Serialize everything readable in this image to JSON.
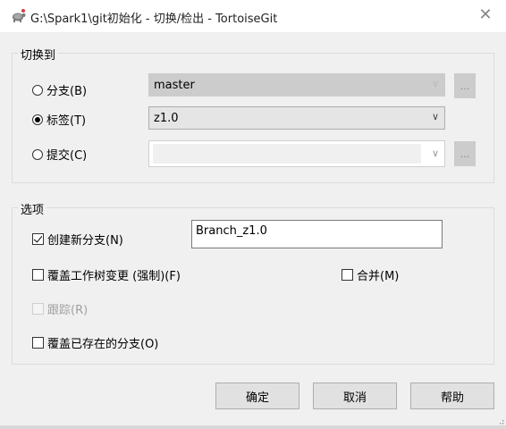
{
  "window": {
    "title": "G:\\Spark1\\git初始化 - 切换/检出 - TortoiseGit",
    "close_glyph": "✕"
  },
  "switch_to": {
    "legend": "切换到",
    "branch": {
      "label": "分支(B)",
      "selected": false,
      "value": "master",
      "enabled": false
    },
    "tag": {
      "label": "标签(T)",
      "selected": true,
      "value": "z1.0",
      "enabled": true
    },
    "commit": {
      "label": "提交(C)",
      "selected": false,
      "value": "",
      "enabled": false
    },
    "browse_label": "..."
  },
  "options": {
    "legend": "选项",
    "create_branch": {
      "label": "创建新分支(N)",
      "checked": true,
      "value": "Branch_z1.0"
    },
    "override_worktree": {
      "label": "覆盖工作树变更 (强制)(F)",
      "checked": false
    },
    "merge": {
      "label": "合并(M)",
      "checked": false
    },
    "track": {
      "label": "跟踪(R)",
      "checked": false,
      "enabled": false
    },
    "override_existing": {
      "label": "覆盖已存在的分支(O)",
      "checked": false
    }
  },
  "buttons": {
    "ok": "确定",
    "cancel": "取消",
    "help": "帮助"
  },
  "icons": {
    "app": "tortoisegit-icon",
    "chevron": "chevron-down-icon"
  }
}
